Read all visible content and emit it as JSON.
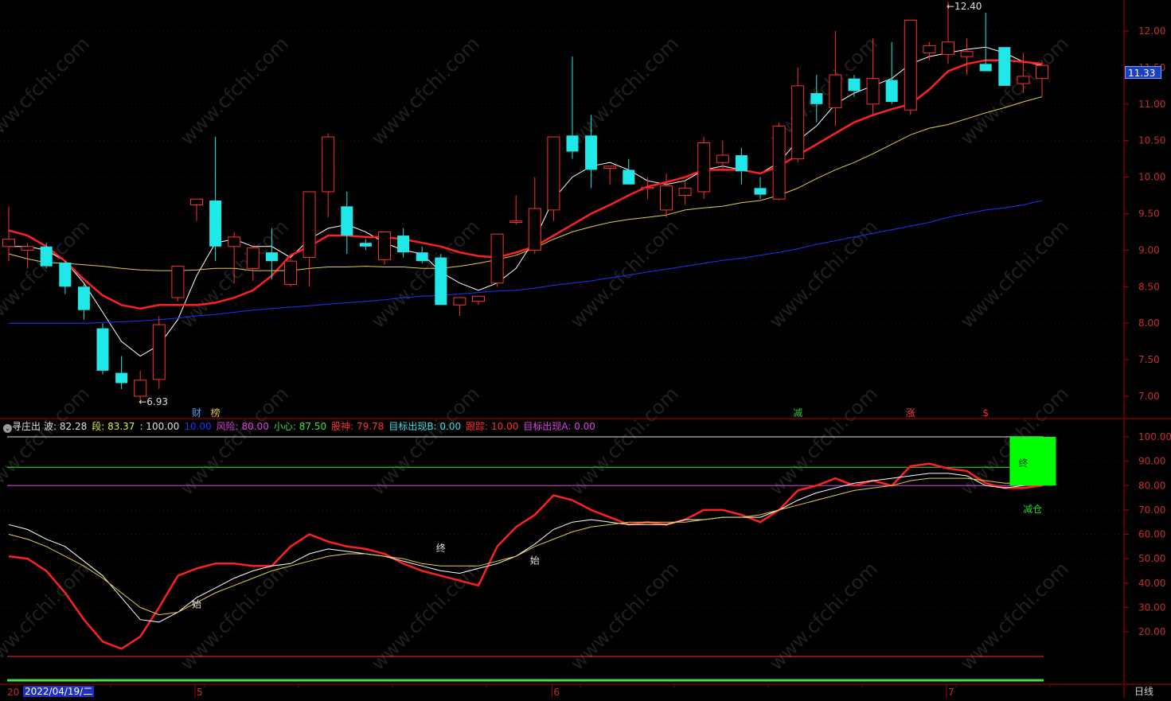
{
  "watermark": "www.cfchi.com",
  "price_panel": {
    "y_ticks": [
      "12.00",
      "11.50",
      "11.00",
      "10.50",
      "10.00",
      "9.50",
      "9.00",
      "8.50",
      "8.00",
      "7.50",
      "7.00"
    ],
    "y_tick_values": [
      12.0,
      11.5,
      11.0,
      10.5,
      10.0,
      9.5,
      9.0,
      8.5,
      8.0,
      7.5,
      7.0
    ],
    "current_price": "11.33",
    "high_label": "12.40",
    "low_label": "6.93",
    "markers": [
      {
        "text": "财",
        "color": "#4da3ff",
        "idx": 10
      },
      {
        "text": "榜",
        "color": "#e8c040",
        "idx": 11
      },
      {
        "text": "减",
        "color": "#2ecc40",
        "idx": 42
      },
      {
        "text": "涨",
        "color": "#ff4040",
        "idx": 48
      },
      {
        "text": "$",
        "color": "#ff3030",
        "idx": 52
      }
    ]
  },
  "indicator": {
    "name": "寻庄出",
    "items": [
      {
        "label": "波: ",
        "value": "82.28",
        "color": "#e0e0e0"
      },
      {
        "label": "段: ",
        "value": "83.37",
        "color": "#e8e840"
      },
      {
        "label": "",
        "value": ": 100.00",
        "color": "#e0e0e0"
      },
      {
        "label": "",
        "value": "10.00",
        "color": "#2030ff"
      },
      {
        "label": "风险: ",
        "value": "80.00",
        "color": "#e040e0"
      },
      {
        "label": "小心: ",
        "value": "87.50",
        "color": "#40e040"
      },
      {
        "label": "股神: ",
        "value": "79.78",
        "color": "#ff3030"
      },
      {
        "label": "目标出现B: ",
        "value": "0.00",
        "color": "#40e0e0"
      },
      {
        "label": "跟踪: ",
        "value": "10.00",
        "color": "#ff3030"
      },
      {
        "label": "目标出现A: ",
        "value": "0.00",
        "color": "#e040e0"
      }
    ],
    "y_ticks": [
      "100.00",
      "90.00",
      "80.00",
      "70.00",
      "60.00",
      "50.00",
      "40.00",
      "30.00",
      "20.00"
    ],
    "y_tick_values": [
      100,
      90,
      80,
      70,
      60,
      50,
      40,
      30,
      20
    ],
    "signals": [
      {
        "text": "始",
        "idx": 10,
        "value": 30
      },
      {
        "text": "终",
        "idx": 23,
        "value": 53
      },
      {
        "text": "始",
        "idx": 28,
        "value": 48
      },
      {
        "text": "终",
        "idx": 54,
        "value": 88
      },
      {
        "text": "减仓",
        "idx": 54.5,
        "value": 69
      }
    ]
  },
  "x_axis": {
    "date_box": "2022/04/19/二",
    "truncated_left": "20",
    "month_labels": [
      {
        "text": "5",
        "idx": 10
      },
      {
        "text": "6",
        "idx": 29
      },
      {
        "text": "7",
        "idx": 50
      }
    ],
    "period": "日线"
  },
  "chart_data": [
    {
      "type": "candlestick",
      "title": "",
      "ylim": [
        6.7,
        12.45
      ],
      "candles": [
        {
          "o": 9.05,
          "h": 9.6,
          "l": 8.85,
          "c": 9.15
        },
        {
          "o": 9.0,
          "h": 9.1,
          "l": 8.75,
          "c": 9.05
        },
        {
          "o": 9.05,
          "h": 9.1,
          "l": 8.75,
          "c": 8.78
        },
        {
          "o": 8.83,
          "h": 8.85,
          "l": 8.4,
          "c": 8.5
        },
        {
          "o": 8.5,
          "h": 8.55,
          "l": 8.05,
          "c": 8.18
        },
        {
          "o": 7.93,
          "h": 8.0,
          "l": 7.3,
          "c": 7.35
        },
        {
          "o": 7.32,
          "h": 7.55,
          "l": 7.1,
          "c": 7.18
        },
        {
          "o": 7.0,
          "h": 7.35,
          "l": 6.93,
          "c": 7.22
        },
        {
          "o": 7.23,
          "h": 8.1,
          "l": 7.1,
          "c": 7.98
        },
        {
          "o": 8.35,
          "h": 8.78,
          "l": 8.3,
          "c": 8.78
        },
        {
          "o": 9.62,
          "h": 9.65,
          "l": 9.4,
          "c": 9.7
        },
        {
          "o": 9.68,
          "h": 10.55,
          "l": 8.85,
          "c": 9.05
        },
        {
          "o": 9.05,
          "h": 9.25,
          "l": 8.55,
          "c": 9.18
        },
        {
          "o": 8.75,
          "h": 9.05,
          "l": 8.58,
          "c": 9.03
        },
        {
          "o": 8.97,
          "h": 9.3,
          "l": 8.6,
          "c": 8.85
        },
        {
          "o": 8.53,
          "h": 8.9,
          "l": 8.5,
          "c": 8.85
        },
        {
          "o": 8.9,
          "h": 9.75,
          "l": 8.5,
          "c": 9.8
        },
        {
          "o": 9.8,
          "h": 10.6,
          "l": 9.45,
          "c": 10.55
        },
        {
          "o": 9.6,
          "h": 9.8,
          "l": 8.95,
          "c": 9.2
        },
        {
          "o": 9.1,
          "h": 9.15,
          "l": 9.0,
          "c": 9.05
        },
        {
          "o": 8.87,
          "h": 9.25,
          "l": 8.8,
          "c": 9.25
        },
        {
          "o": 9.2,
          "h": 9.3,
          "l": 8.9,
          "c": 8.97
        },
        {
          "o": 8.97,
          "h": 9.05,
          "l": 8.82,
          "c": 8.85
        },
        {
          "o": 8.9,
          "h": 8.95,
          "l": 8.25,
          "c": 8.25
        },
        {
          "o": 8.25,
          "h": 8.35,
          "l": 8.1,
          "c": 8.35
        },
        {
          "o": 8.3,
          "h": 8.35,
          "l": 8.25,
          "c": 8.37
        },
        {
          "o": 8.55,
          "h": 9.2,
          "l": 8.5,
          "c": 9.22
        },
        {
          "o": 9.38,
          "h": 9.75,
          "l": 9.35,
          "c": 9.4
        },
        {
          "o": 9.0,
          "h": 10.0,
          "l": 8.95,
          "c": 9.57
        },
        {
          "o": 9.55,
          "h": 10.1,
          "l": 9.4,
          "c": 10.55
        },
        {
          "o": 10.57,
          "h": 11.65,
          "l": 10.25,
          "c": 10.35
        },
        {
          "o": 10.57,
          "h": 10.85,
          "l": 9.85,
          "c": 10.1
        },
        {
          "o": 10.12,
          "h": 10.15,
          "l": 9.9,
          "c": 10.15
        },
        {
          "o": 10.1,
          "h": 10.25,
          "l": 9.9,
          "c": 9.9
        },
        {
          "o": 9.85,
          "h": 10.0,
          "l": 9.7,
          "c": 9.86
        },
        {
          "o": 9.55,
          "h": 10.05,
          "l": 9.45,
          "c": 9.88
        },
        {
          "o": 9.75,
          "h": 9.95,
          "l": 9.62,
          "c": 9.85
        },
        {
          "o": 9.8,
          "h": 10.55,
          "l": 9.7,
          "c": 10.47
        },
        {
          "o": 10.2,
          "h": 10.5,
          "l": 10.1,
          "c": 10.3
        },
        {
          "o": 10.3,
          "h": 10.4,
          "l": 9.9,
          "c": 10.08
        },
        {
          "o": 9.85,
          "h": 10.0,
          "l": 9.7,
          "c": 9.76
        },
        {
          "o": 9.7,
          "h": 10.75,
          "l": 9.68,
          "c": 10.7
        },
        {
          "o": 10.25,
          "h": 11.5,
          "l": 10.2,
          "c": 11.25
        },
        {
          "o": 11.15,
          "h": 11.4,
          "l": 10.75,
          "c": 11.0
        },
        {
          "o": 10.95,
          "h": 12.0,
          "l": 10.7,
          "c": 11.4
        },
        {
          "o": 11.35,
          "h": 11.4,
          "l": 11.1,
          "c": 11.18
        },
        {
          "o": 11.0,
          "h": 11.9,
          "l": 10.85,
          "c": 11.35
        },
        {
          "o": 11.33,
          "h": 11.85,
          "l": 11.0,
          "c": 11.03
        },
        {
          "o": 10.92,
          "h": 12.15,
          "l": 10.85,
          "c": 12.15
        },
        {
          "o": 11.7,
          "h": 11.85,
          "l": 11.6,
          "c": 11.8
        },
        {
          "o": 11.68,
          "h": 12.4,
          "l": 11.55,
          "c": 11.85
        },
        {
          "o": 11.65,
          "h": 11.9,
          "l": 11.4,
          "c": 11.72
        },
        {
          "o": 11.55,
          "h": 12.25,
          "l": 11.5,
          "c": 11.45
        },
        {
          "o": 11.78,
          "h": 11.78,
          "l": 11.6,
          "c": 11.25
        },
        {
          "o": 11.28,
          "h": 11.7,
          "l": 11.15,
          "c": 11.38
        },
        {
          "o": 11.35,
          "h": 11.6,
          "l": 11.1,
          "c": 11.53
        }
      ],
      "series": [
        {
          "color": "#ffffff",
          "values": [
            9.05,
            9.05,
            9.0,
            8.85,
            8.55,
            8.15,
            7.75,
            7.55,
            7.7,
            8.05,
            8.65,
            9.1,
            9.15,
            9.05,
            9.05,
            8.9,
            9.15,
            9.3,
            9.35,
            9.25,
            9.1,
            9.0,
            8.95,
            8.7,
            8.55,
            8.45,
            8.55,
            8.75,
            9.15,
            9.7,
            10.0,
            10.15,
            10.2,
            10.1,
            9.95,
            9.9,
            9.95,
            10.1,
            10.15,
            10.1,
            10.05,
            10.2,
            10.5,
            10.7,
            11.0,
            11.15,
            11.25,
            11.35,
            11.55,
            11.65,
            11.7,
            11.75,
            11.78,
            11.7,
            11.58,
            11.53
          ]
        },
        {
          "color": "#ff2020",
          "values": [
            9.27,
            9.2,
            9.05,
            8.85,
            8.6,
            8.38,
            8.25,
            8.2,
            8.25,
            8.25,
            8.25,
            8.28,
            8.35,
            8.45,
            8.65,
            8.93,
            9.05,
            9.2,
            9.2,
            9.18,
            9.18,
            9.15,
            9.1,
            9.05,
            8.97,
            8.92,
            8.9,
            8.97,
            9.05,
            9.2,
            9.35,
            9.5,
            9.62,
            9.75,
            9.87,
            9.93,
            10.0,
            10.1,
            10.1,
            10.1,
            10.05,
            10.15,
            10.3,
            10.45,
            10.6,
            10.75,
            10.85,
            10.93,
            11.0,
            11.2,
            11.45,
            11.55,
            11.6,
            11.6,
            11.58,
            11.55
          ]
        },
        {
          "color": "#e0d040",
          "values": [
            8.95,
            8.88,
            8.83,
            8.82,
            8.8,
            8.78,
            8.75,
            8.73,
            8.72,
            8.72,
            8.73,
            8.75,
            8.75,
            8.72,
            8.72,
            8.72,
            8.75,
            8.77,
            8.77,
            8.78,
            8.77,
            8.77,
            8.75,
            8.75,
            8.78,
            8.82,
            8.87,
            8.93,
            9.03,
            9.15,
            9.25,
            9.32,
            9.38,
            9.42,
            9.45,
            9.48,
            9.55,
            9.58,
            9.6,
            9.65,
            9.68,
            9.75,
            9.85,
            9.98,
            10.1,
            10.2,
            10.32,
            10.45,
            10.58,
            10.67,
            10.72,
            10.8,
            10.88,
            10.95,
            11.03,
            11.1
          ]
        },
        {
          "color": "#2030ff",
          "values": [
            8.0,
            8.0,
            8.0,
            8.0,
            8.0,
            8.01,
            8.02,
            8.03,
            8.05,
            8.07,
            8.1,
            8.12,
            8.15,
            8.18,
            8.2,
            8.22,
            8.24,
            8.26,
            8.28,
            8.3,
            8.32,
            8.35,
            8.37,
            8.38,
            8.4,
            8.42,
            8.44,
            8.45,
            8.48,
            8.52,
            8.55,
            8.58,
            8.62,
            8.66,
            8.7,
            8.74,
            8.78,
            8.82,
            8.86,
            8.89,
            8.93,
            8.97,
            9.02,
            9.08,
            9.13,
            9.18,
            9.23,
            9.28,
            9.33,
            9.38,
            9.45,
            9.5,
            9.55,
            9.58,
            9.62,
            9.68
          ]
        }
      ]
    },
    {
      "type": "line",
      "title": "寻庄出",
      "ylim": [
        0,
        105
      ],
      "x": [
        0,
        1,
        2,
        3,
        4,
        5,
        6,
        7,
        8,
        9,
        10,
        11,
        12,
        13,
        14,
        15,
        16,
        17,
        18,
        19,
        20,
        21,
        22,
        23,
        24,
        25,
        26,
        27,
        28,
        29,
        30,
        31,
        32,
        33,
        34,
        35,
        36,
        37,
        38,
        39,
        40,
        41,
        42,
        43,
        44,
        45,
        46,
        47,
        48,
        49,
        50,
        51,
        52,
        53,
        54,
        55
      ],
      "series": [
        {
          "name": "股神",
          "color": "#ff2020",
          "values": [
            51,
            50,
            45,
            36,
            25,
            16,
            13,
            18,
            30,
            43,
            46,
            48,
            48,
            47,
            47,
            55,
            60,
            57,
            55,
            54,
            52,
            48,
            45,
            43,
            41,
            39,
            55,
            63,
            68,
            76,
            74,
            70,
            67,
            64,
            65,
            64,
            66,
            70,
            70,
            68,
            65,
            70,
            78,
            80,
            83,
            80,
            82,
            80,
            88,
            89,
            87,
            86,
            81,
            79,
            79,
            80
          ]
        },
        {
          "name": "波",
          "color": "#ffffff",
          "values": [
            64,
            62,
            58,
            55,
            49,
            43,
            34,
            25,
            24,
            28,
            34,
            38,
            42,
            45,
            47,
            48,
            52,
            54,
            53,
            52,
            51,
            49,
            47,
            45,
            44,
            46,
            48,
            51,
            56,
            62,
            65,
            66,
            65,
            64,
            64,
            64,
            66,
            66,
            67,
            67,
            67,
            70,
            74,
            77,
            79,
            81,
            82,
            83,
            84,
            85,
            85,
            84,
            80,
            79,
            80,
            82
          ]
        },
        {
          "name": "段",
          "color": "#e0d040",
          "values": [
            60,
            58,
            55,
            51,
            47,
            42,
            36,
            30,
            27,
            28,
            32,
            36,
            39,
            42,
            45,
            47,
            49,
            51,
            52,
            52,
            51,
            50,
            48,
            47,
            47,
            47,
            49,
            51,
            55,
            58,
            61,
            63,
            64,
            65,
            65,
            65,
            65,
            66,
            67,
            67,
            68,
            70,
            72,
            74,
            76,
            78,
            79,
            80,
            82,
            83,
            83,
            83,
            82,
            81,
            81,
            82
          ]
        }
      ],
      "reference_lines": [
        {
          "value": 100,
          "color": "#e0e0e0"
        },
        {
          "value": 87.5,
          "color": "#40e040"
        },
        {
          "value": 80,
          "color": "#e040e0"
        },
        {
          "value": 10,
          "color": "#ff3030"
        },
        {
          "value": 0,
          "color": "#40e040"
        }
      ]
    }
  ]
}
